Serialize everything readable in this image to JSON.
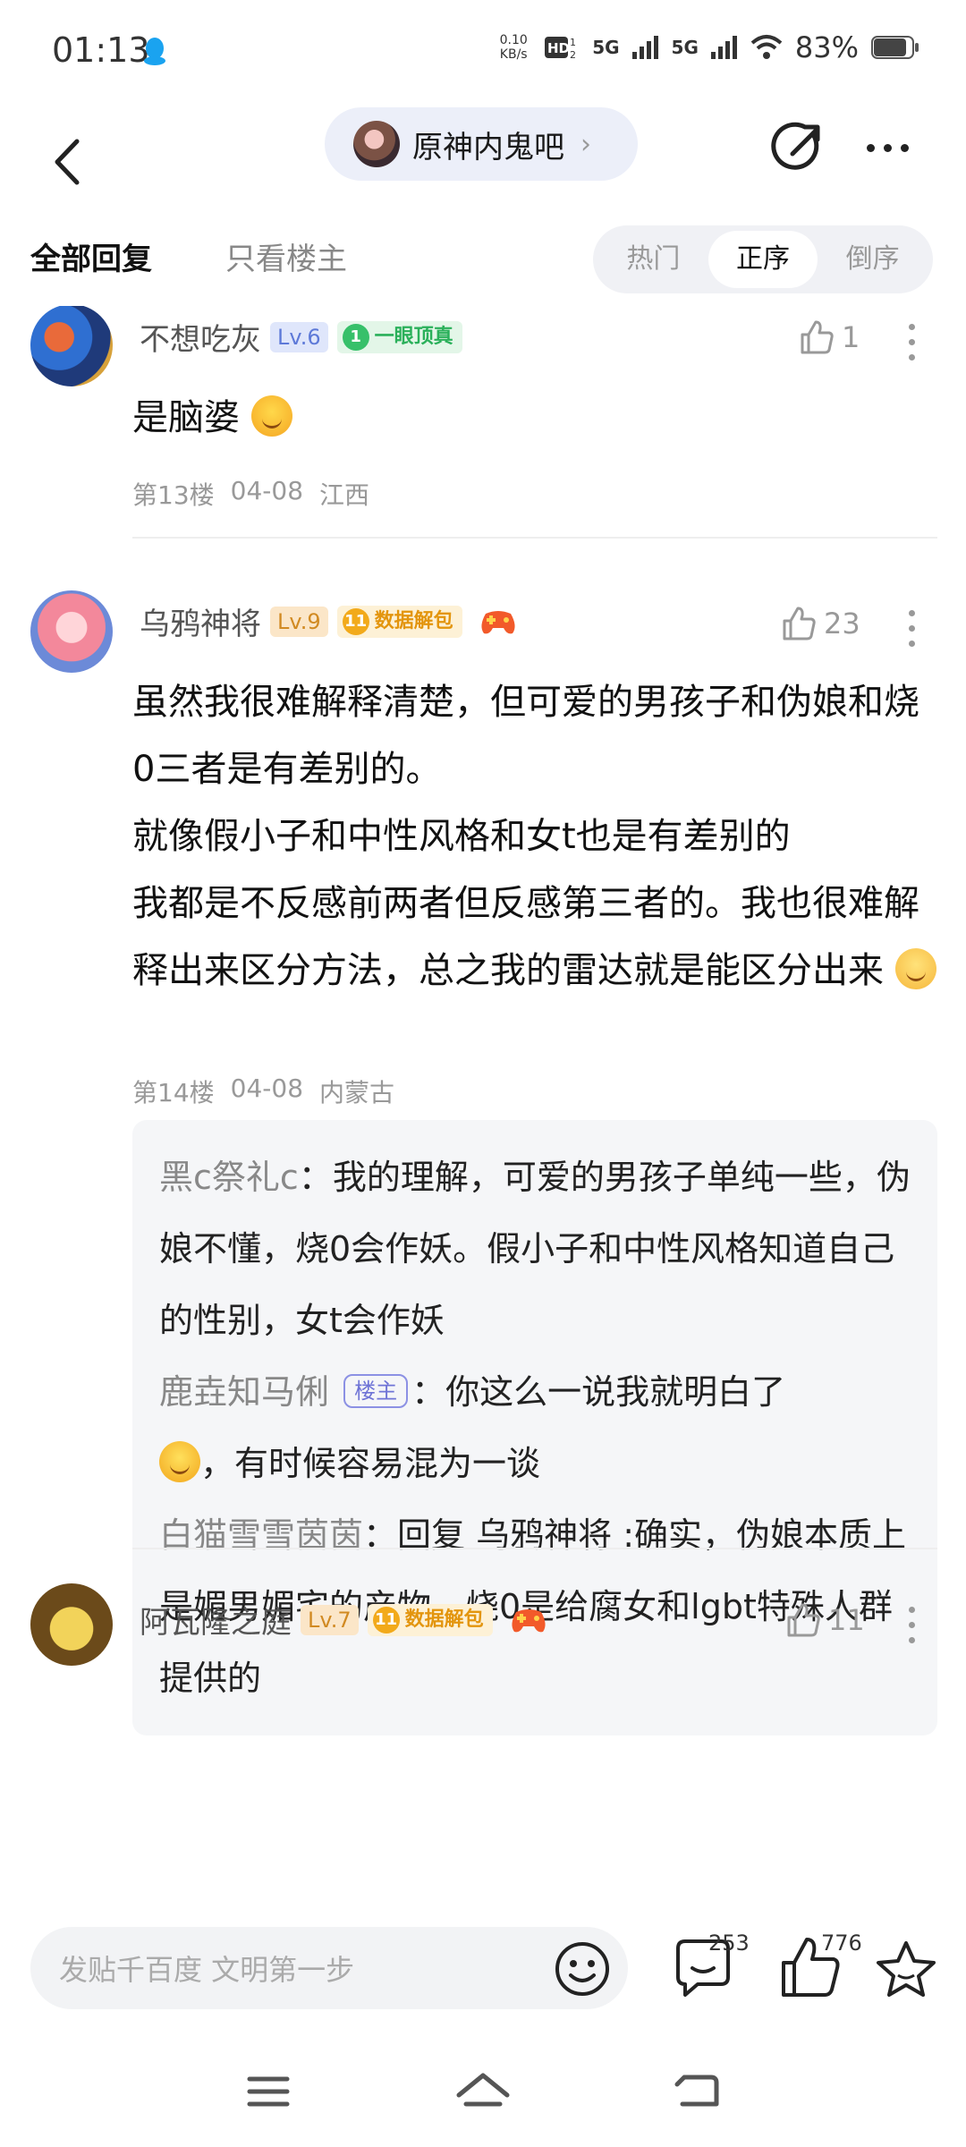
{
  "status": {
    "time": "01:13",
    "speed": "0.10\nKB/s",
    "net1": "5G",
    "net2": "5G",
    "battery": "83%"
  },
  "header": {
    "forum_name": "原神内鬼吧"
  },
  "tabs": {
    "all": "全部回复",
    "op_only": "只看楼主",
    "sort": [
      "热门",
      "正序",
      "倒序"
    ]
  },
  "posts": [
    {
      "user": "不想吃灰",
      "level": "Lv.6",
      "badge_num": "1",
      "badge": "一眼顶真",
      "likes": "1",
      "text": "是脑婆",
      "floor": "第13楼",
      "date": "04-08",
      "region": "江西"
    },
    {
      "user": "乌鸦神将",
      "level": "Lv.9",
      "badge_num": "11",
      "badge": "数据解包",
      "likes": "23",
      "text": "虽然我很难解释清楚，但可爱的男孩子和伪娘和烧0三者是有差别的。\n就像假小子和中性风格和女t也是有差别的\n我都是不反感前两者但反感第三者的。我也很难解释出来区分方法，总之我的雷达就是能区分出来",
      "floor": "第14楼",
      "date": "04-08",
      "region": "内蒙古",
      "replies": [
        {
          "name": "黑c祭礼c",
          "text": "我的理解，可爱的男孩子单纯一些，伪娘不懂，烧0会作妖。假小子和中性风格知道自己的性别，女t会作妖"
        },
        {
          "name": "鹿垚知马俐",
          "tag": "楼主",
          "text_a": "你这么一说我就明白了",
          "text_b": "，有时候容易混为一谈"
        },
        {
          "name": "白猫雪雪茵茵",
          "text": "回复 乌鸦神将 :确实，伪娘本质上是媚男媚宅的产物。烧0是给腐女和lgbt特殊人群提供的"
        }
      ]
    },
    {
      "user": "阿瓦隆之庭",
      "level": "Lv.7",
      "badge_num": "11",
      "badge": "数据解包",
      "likes": "11"
    }
  ],
  "bottom": {
    "placeholder": "发贴千百度 文明第一步",
    "reply_count": "253",
    "like_count": "776"
  }
}
